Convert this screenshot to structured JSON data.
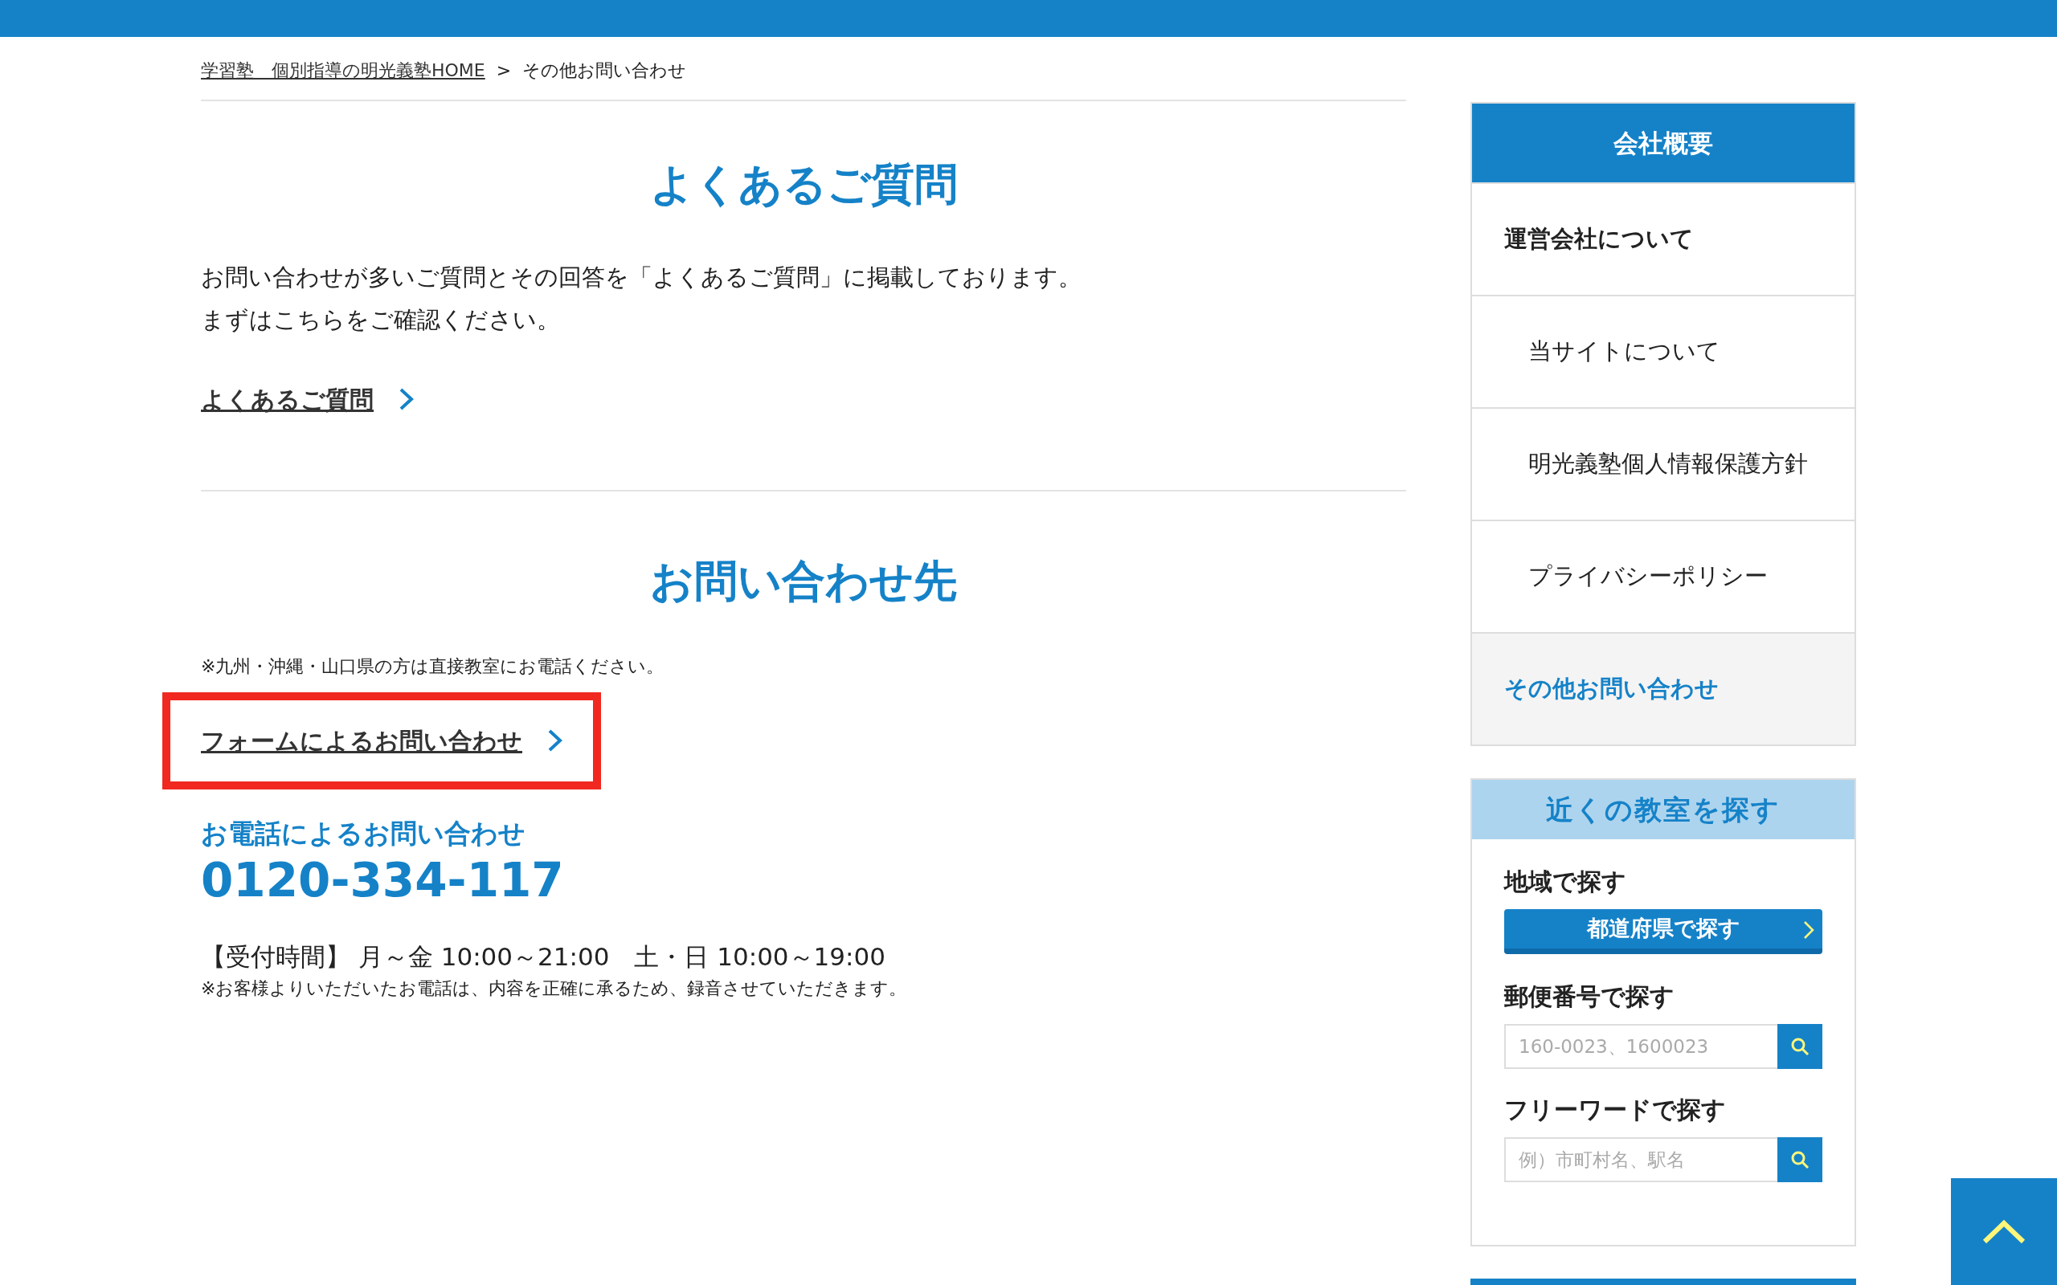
{
  "breadcrumb": [
    {
      "label": "学習塾　個別指導の明光義塾HOME",
      "kind": "link"
    },
    {
      "label": "その他お問い合わせ",
      "kind": "current"
    }
  ],
  "breadcrumb_separator": ">",
  "faq": {
    "title": "よくあるご質問",
    "lines": [
      "お問い合わせが多いご質問とその回答を「よくあるご質問」に掲載しております。",
      "まずはこちらをご確認ください。"
    ],
    "link": "よくあるご質問"
  },
  "contact": {
    "title": "お問い合わせ先",
    "note": "※九州・沖縄・山口県の方は直接教室にお電話ください。",
    "form_link": "フォームによるお問い合わせ",
    "form_link_highlighted": true,
    "phone_heading": "お電話によるお問い合わせ",
    "phone_number": "0120-334-117",
    "hours": "【受付時間】 月～金 10:00～21:00　土・日 10:00～19:00",
    "recording_note": "※お客様よりいただいたお電話は、内容を正確に承るため、録音させていただきます。"
  },
  "sidebar": {
    "title": "会社概要",
    "items": [
      {
        "label": "運営会社について",
        "kind": "parent",
        "selected": false
      },
      {
        "label": "当サイトについて",
        "kind": "child",
        "selected": false
      },
      {
        "label": "明光義塾個人情報保護方針",
        "kind": "child",
        "selected": false
      },
      {
        "label": "プライバシーポリシー",
        "kind": "child",
        "selected": false
      },
      {
        "label": "その他お問い合わせ",
        "kind": "parent",
        "selected": true
      }
    ]
  },
  "school_search": {
    "title": "近くの教室を探す",
    "sections": [
      {
        "heading": "地域で探す",
        "kind": "button",
        "button": "都道府県で探す"
      },
      {
        "heading": "郵便番号で探す",
        "kind": "field",
        "placeholder": "160-0023、1600023"
      },
      {
        "heading": "フリーワードで探す",
        "kind": "field",
        "placeholder": "例）市町村名、駅名"
      }
    ]
  }
}
